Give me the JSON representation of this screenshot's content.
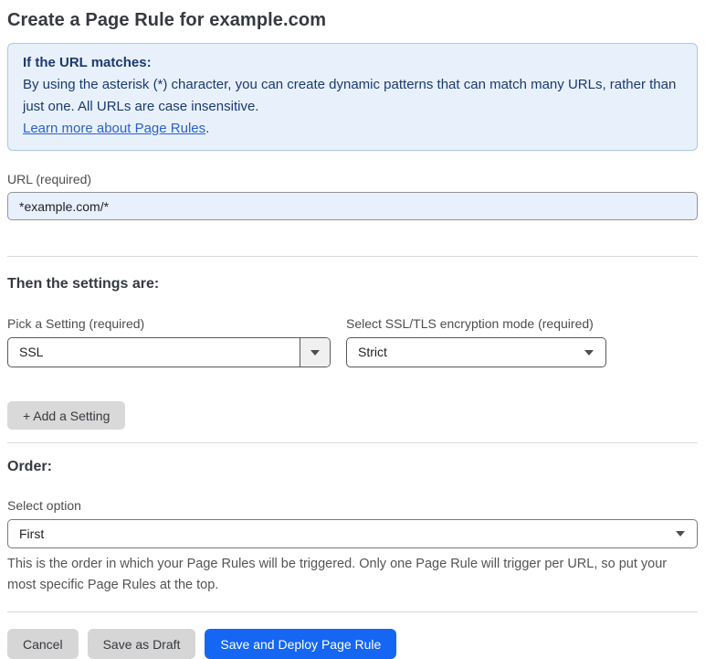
{
  "page": {
    "title": "Create a Page Rule for example.com"
  },
  "info_box": {
    "heading": "If the URL matches:",
    "body": "By using the asterisk (*) character, you can create dynamic patterns that can match many URLs, rather than just one. All URLs are case insensitive.",
    "link_label": "Learn more about Page Rules",
    "link_suffix": "."
  },
  "url_field": {
    "label": "URL (required)",
    "value": "*example.com/*"
  },
  "settings_section": {
    "heading": "Then the settings are:",
    "setting_picker": {
      "label": "Pick a Setting (required)",
      "value": "SSL"
    },
    "ssl_mode_picker": {
      "label": "Select SSL/TLS encryption mode (required)",
      "value": "Strict"
    },
    "add_setting_label": "+ Add a Setting"
  },
  "order_section": {
    "heading": "Order:",
    "label": "Select option",
    "value": "First",
    "help_text": "This is the order in which your Page Rules will be triggered. Only one Page Rule will trigger per URL, so put your most specific Page Rules at the top."
  },
  "actions": {
    "cancel_label": "Cancel",
    "save_draft_label": "Save as Draft",
    "save_deploy_label": "Save and Deploy Page Rule"
  },
  "colors": {
    "info_bg": "#e8f1fb",
    "info_border": "#a9c9ea",
    "info_text": "#1b3a70",
    "link_blue": "#2b62c9",
    "autofill_input_bg": "#e8f0fe",
    "primary_button_bg": "#1566f2",
    "gray_button_bg": "#d6d6d6"
  },
  "icons": {
    "dropdown_arrow": "caret-down"
  }
}
